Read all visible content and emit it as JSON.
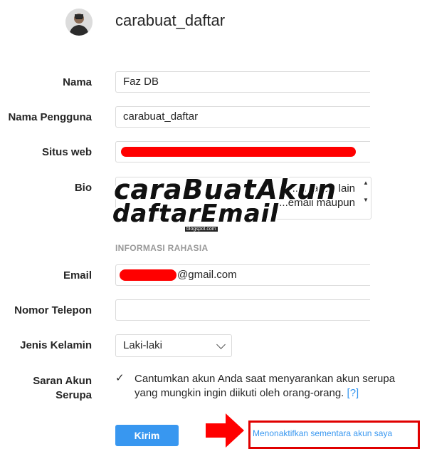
{
  "header": {
    "username": "carabuat_daftar"
  },
  "form": {
    "name_label": "Nama",
    "name_value": "Faz DB",
    "username_label": "Nama Pengguna",
    "username_value": "carabuat_daftar",
    "website_label": "Situs web",
    "bio_label": "Bio",
    "bio_value_line1": "...al, akun lain",
    "bio_value_line2": "...email maupun",
    "private_section_title": "INFORMASI RAHASIA",
    "email_label": "Email",
    "email_value": "@gmail.com",
    "phone_label": "Nomor Telepon",
    "phone_value": "",
    "gender_label": "Jenis Kelamin",
    "gender_value": "Laki-laki",
    "suggest_label_line1": "Saran Akun",
    "suggest_label_line2": "Serupa",
    "suggest_checkbox": "✓",
    "suggest_text": "Cantumkan akun Anda saat menyarankan akun serupa yang mungkin ingin diikuti oleh orang-orang.",
    "suggest_help": "[?]",
    "submit_label": "Kirim",
    "deactivate_link": "Menonaktifkan sementara akun saya"
  },
  "watermark": {
    "line1": "caraBuatAkun",
    "line2": "daftarEmail",
    "line3": "blogspot.com"
  },
  "colors": {
    "accent": "#3897f0",
    "highlight": "#e00000",
    "border": "#dbdbdb"
  }
}
